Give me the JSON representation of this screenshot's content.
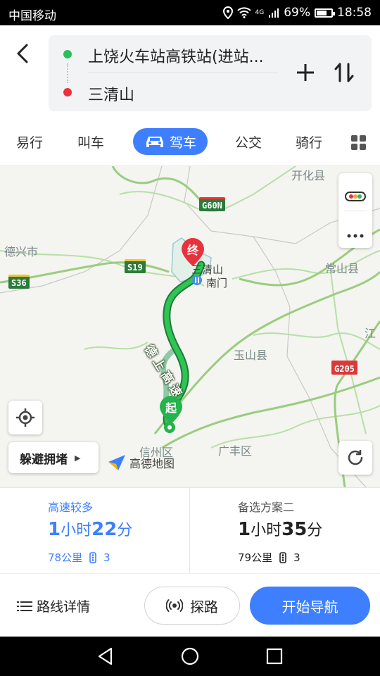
{
  "status_bar": {
    "carrier": "中国移动",
    "network": "4G",
    "battery_text": "69%",
    "battery_level": 0.69,
    "time": "18:58"
  },
  "route": {
    "from": "上饶火车站高铁站(进站...",
    "to": "三清山",
    "icons": {
      "back": "back-arrow-icon",
      "add": "plus-icon",
      "swap": "swap-icon"
    }
  },
  "tabs": [
    {
      "label": "易行"
    },
    {
      "label": "叫车"
    },
    {
      "label": "驾车",
      "active": true,
      "icon": "car-icon"
    },
    {
      "label": "公交"
    },
    {
      "label": "骑行"
    }
  ],
  "map": {
    "labels": {
      "kaihua": "开化县",
      "dexing": "德兴市",
      "changshan": "常山县",
      "yushan": "玉山县",
      "jiang": "江",
      "xinzhou": "信州区",
      "guangfeng": "广丰区",
      "sanqing_1": "三清山",
      "sanqing_2": "南门",
      "highway": "德上高速"
    },
    "shields": {
      "g60n": "G60N",
      "s19": "S19",
      "s36": "S36",
      "g205": "G205"
    },
    "markers": {
      "end": "终",
      "start": "起"
    },
    "avoid_label": "躲避拥堵",
    "logo_text": "高德地图",
    "colors": {
      "route": "#25b34b",
      "alt_route": "#8fc9a8",
      "accent": "#3d7fff",
      "end_marker": "#e8333c",
      "start_marker": "#25b34b"
    }
  },
  "options": [
    {
      "tag": "高速较多",
      "hours": "1",
      "hour_unit": "小时",
      "minutes": "22",
      "minute_unit": "分",
      "distance": "78公里",
      "lights": "3",
      "selected": true
    },
    {
      "tag": "备选方案二",
      "hours": "1",
      "hour_unit": "小时",
      "minutes": "35",
      "minute_unit": "分",
      "distance": "79公里",
      "lights": "3",
      "selected": false
    }
  ],
  "actions": {
    "details": "路线详情",
    "explore": "探路",
    "start": "开始导航"
  }
}
